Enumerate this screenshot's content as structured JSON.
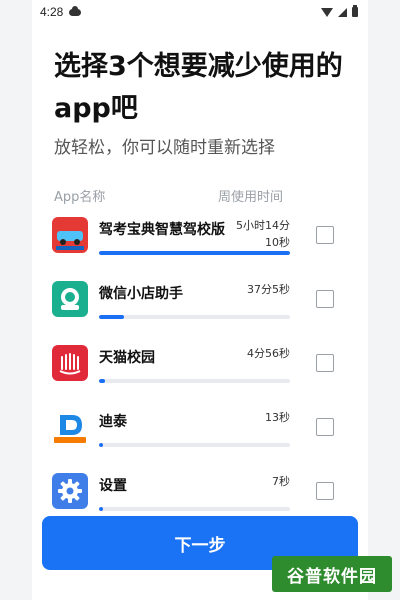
{
  "status_bar": {
    "time": "4:28"
  },
  "header": {
    "title": "选择3个想要减少使用的app吧",
    "subtitle": "放轻松，你可以随时重新选择"
  },
  "columns": {
    "app": "App名称",
    "time": "周使用时间"
  },
  "apps": [
    {
      "name": "驾考宝典智慧驾校版",
      "time": "5小时14分10秒",
      "usage_fraction": 1.0,
      "icon": "car-app-icon",
      "icon_color": "#e53935",
      "checked": false
    },
    {
      "name": "微信小店助手",
      "time": "37分5秒",
      "usage_fraction": 0.13,
      "icon": "shop-assistant-icon",
      "icon_color": "#1aaf8e",
      "checked": false
    },
    {
      "name": "天猫校园",
      "time": "4分56秒",
      "usage_fraction": 0.03,
      "icon": "tmall-campus-icon",
      "icon_color": "#e02a3a",
      "checked": false
    },
    {
      "name": "迪泰",
      "time": "13秒",
      "usage_fraction": 0.02,
      "icon": "ditai-icon",
      "icon_color": "#f57c00",
      "checked": false
    },
    {
      "name": "设置",
      "time": "7秒",
      "usage_fraction": 0.02,
      "icon": "settings-gear-icon",
      "icon_color": "#3f7de8",
      "checked": false
    }
  ],
  "next_button": {
    "label": "下一步"
  },
  "watermark": {
    "text": "谷普软件园"
  }
}
